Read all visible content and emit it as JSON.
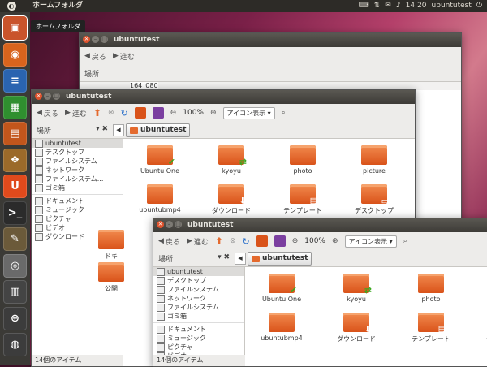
{
  "top_panel": {
    "title": "ホームフォルダ",
    "home_icon": "ubuntu-logo-icon",
    "time": "14:20",
    "user": "ubuntutest"
  },
  "launcher": {
    "tooltip": "ホームフォルダ",
    "items": [
      {
        "name": "home-folder-icon",
        "color": "#c9542b",
        "glyph": "▣"
      },
      {
        "name": "firefox-icon",
        "color": "#d8641d",
        "glyph": "◉"
      },
      {
        "name": "writer-icon",
        "color": "#2a64b0",
        "glyph": "≡"
      },
      {
        "name": "calc-icon",
        "color": "#2f8f2f",
        "glyph": "▦"
      },
      {
        "name": "impress-icon",
        "color": "#c2561c",
        "glyph": "▤"
      },
      {
        "name": "software-center-icon",
        "color": "#9b6a2a",
        "glyph": "❖"
      },
      {
        "name": "ubuntu-one-icon",
        "color": "#e04a1c",
        "glyph": "U"
      },
      {
        "name": "terminal-icon",
        "color": "#2b2b2b",
        "glyph": ">_"
      },
      {
        "name": "gimp-icon",
        "color": "#6b5a3a",
        "glyph": "✎"
      },
      {
        "name": "camera-icon",
        "color": "#6a6a6a",
        "glyph": "◎"
      },
      {
        "name": "workspace-switcher-icon",
        "color": "#444444",
        "glyph": "▥"
      },
      {
        "name": "trash-icon",
        "color": "#3c3c3c",
        "glyph": "⊕"
      },
      {
        "name": "trash-bin-icon",
        "color": "#3c3c3c",
        "glyph": "◍"
      }
    ]
  },
  "window": {
    "title": "ubuntutest",
    "back": "戻る",
    "forward": "進む",
    "zoom": "100%",
    "view": "アイコン表示",
    "places": "場所",
    "crumb": "ubuntutest",
    "status": "14個のアイテム",
    "sidebar": [
      "ubuntutest",
      "デスクトップ",
      "ファイルシステム",
      "ネットワーク",
      "ファイルシステム...",
      "ゴミ箱",
      "ドキュメント",
      "ミュージック",
      "ピクチャ",
      "ビデオ",
      "ダウンロード"
    ],
    "files": [
      {
        "label": "Ubuntu One",
        "badge": "✔",
        "badge_color": "#3aa81f"
      },
      {
        "label": "kyoyu",
        "badge": "⇄",
        "badge_color": "#3aa81f"
      },
      {
        "label": "photo",
        "badge": "",
        "badge_color": ""
      },
      {
        "label": "picture",
        "badge": "",
        "badge_color": ""
      },
      {
        "label": "ubuntubmp4",
        "badge": "",
        "badge_color": ""
      },
      {
        "label": "ダウンロード",
        "badge": "⬇",
        "badge_color": "#ffffff"
      },
      {
        "label": "テンプレート",
        "badge": "▤",
        "badge_color": "#ffffff"
      },
      {
        "label": "デスクトップ",
        "badge": "▭",
        "badge_color": "#ffffff"
      }
    ],
    "mid_extra": [
      "ドキ",
      "公開"
    ],
    "back_extra": "164_080"
  },
  "colors": {
    "panel": "#2d2b27",
    "launcher": "#3b3a36",
    "folder": "#e46a2e",
    "close": "#e0532d"
  }
}
